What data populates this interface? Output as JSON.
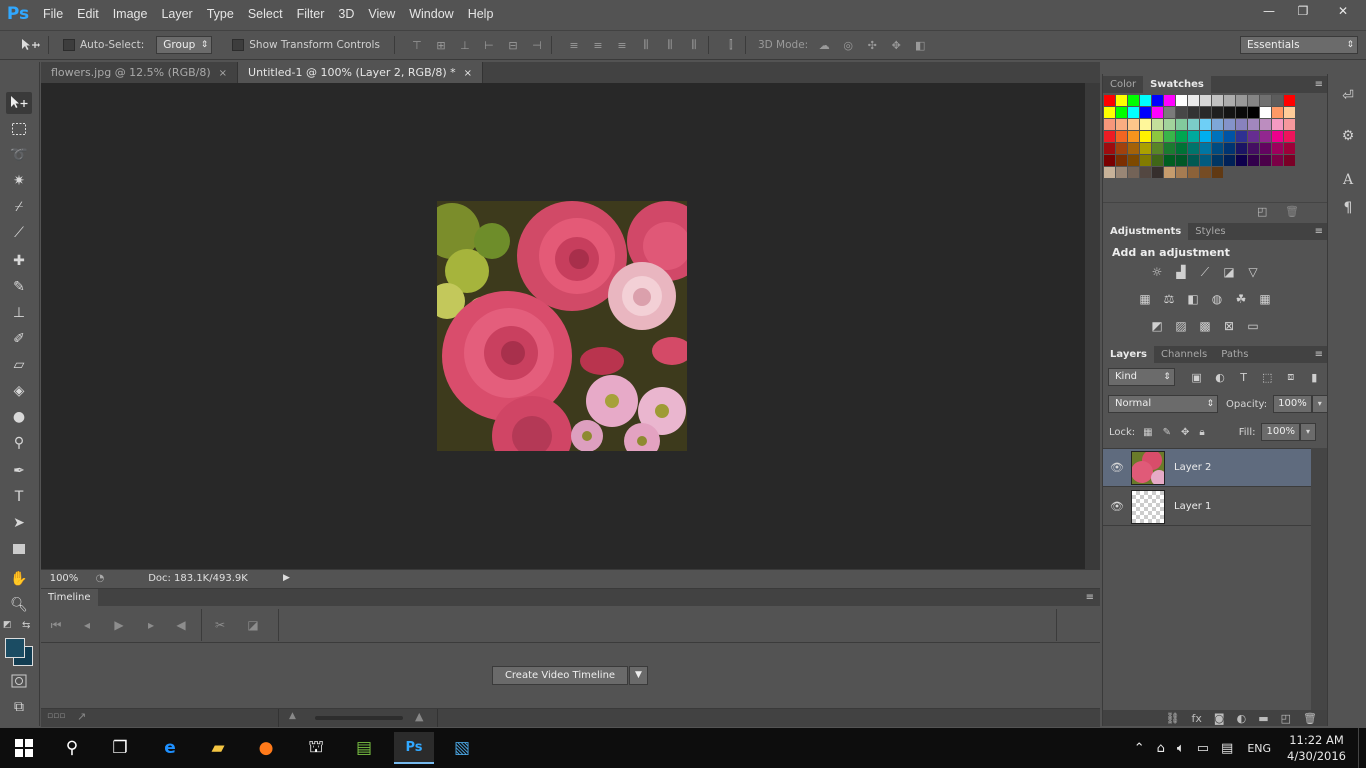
{
  "app": {
    "logo": "Ps"
  },
  "menu": [
    "File",
    "Edit",
    "Image",
    "Layer",
    "Type",
    "Select",
    "Filter",
    "3D",
    "View",
    "Window",
    "Help"
  ],
  "window_controls": {
    "minimize": "—",
    "restore": "❐",
    "close": "✕"
  },
  "options": {
    "auto_select_label": "Auto-Select:",
    "auto_select_value": "Group",
    "show_transform_label": "Show Transform Controls",
    "mode_3d_label": "3D Mode:",
    "workspace": "Essentials"
  },
  "tabs": [
    {
      "label": "flowers.jpg @ 12.5% (RGB/8)",
      "close": "×"
    },
    {
      "label": "Untitled-1 @ 100% (Layer 2, RGB/8) *",
      "close": "×"
    }
  ],
  "status": {
    "zoom": "100%",
    "doc": "Doc: 183.1K/493.9K"
  },
  "timeline": {
    "tab": "Timeline",
    "create_button": "Create Video Timeline"
  },
  "color_panel": {
    "tabs": [
      "Color",
      "Swatches"
    ],
    "menu": "≡"
  },
  "swatch_colors": [
    [
      "#ff0000",
      "#ffff00",
      "#00ff00",
      "#00ffff",
      "#0000ff",
      "#ff00ff",
      "#ffffff",
      "#ebebeb",
      "#d6d6d6",
      "#c2c2c2",
      "#adadad",
      "#999999",
      "#858585",
      "#707070",
      "#5c5c5c",
      "#ff0000"
    ],
    [
      "#ffff00",
      "#00ff00",
      "#00ffff",
      "#0000ff",
      "#ff00ff",
      "#7a7a7a",
      "#474747",
      "#333333",
      "#292929",
      "#1f1f1f",
      "#141414",
      "#0a0a0a",
      "#000000",
      "#ffffff",
      "#ff9966",
      "#ffcc99"
    ],
    [
      "#f7977a",
      "#f9ad81",
      "#fdc68a",
      "#fff79a",
      "#c4df9b",
      "#a2d39c",
      "#82ca9d",
      "#7bcdc8",
      "#6ecff6",
      "#7ea7d8",
      "#8493ca",
      "#8882be",
      "#a187be",
      "#bc8dbf",
      "#f49ac2",
      "#f6989d"
    ],
    [
      "#ed1c24",
      "#f26522",
      "#f7941d",
      "#fff200",
      "#8dc63f",
      "#39b54a",
      "#00a651",
      "#00a99d",
      "#00aeef",
      "#0072bc",
      "#0054a6",
      "#2e3192",
      "#662d91",
      "#92278f",
      "#ec008c",
      "#ed145b"
    ],
    [
      "#9e0b0f",
      "#a0410d",
      "#a36209",
      "#aba000",
      "#598527",
      "#1a7b30",
      "#007236",
      "#00746b",
      "#0076a3",
      "#004b80",
      "#003471",
      "#1b1464",
      "#440e62",
      "#630460",
      "#9e005d",
      "#9e0039"
    ],
    [
      "#790000",
      "#7b2e00",
      "#7d4900",
      "#827b00",
      "#406618",
      "#005e20",
      "#005826",
      "#005952",
      "#005b7f",
      "#003663",
      "#002157",
      "#0d004c",
      "#32004b",
      "#4b0049",
      "#7b0046",
      "#7a0026"
    ],
    [
      "#c7b299",
      "#998675",
      "#736357",
      "#534741",
      "#362f2d",
      "#c69c6d",
      "#a67c52",
      "#8c6239",
      "#754c24",
      "#603913"
    ]
  ],
  "adjustments": {
    "tabs": [
      "Adjustments",
      "Styles"
    ],
    "title": "Add an adjustment"
  },
  "layers": {
    "tabs": [
      "Layers",
      "Channels",
      "Paths"
    ],
    "kind": "Kind",
    "blend_mode": "Normal",
    "opacity_label": "Opacity:",
    "opacity_value": "100%",
    "lock_label": "Lock:",
    "fill_label": "Fill:",
    "fill_value": "100%",
    "items": [
      {
        "name": "Layer 2",
        "selected": true
      },
      {
        "name": "Layer 1",
        "selected": false
      }
    ]
  },
  "taskbar": {
    "lang": "ENG",
    "time": "11:22 AM",
    "date": "4/30/2016"
  }
}
